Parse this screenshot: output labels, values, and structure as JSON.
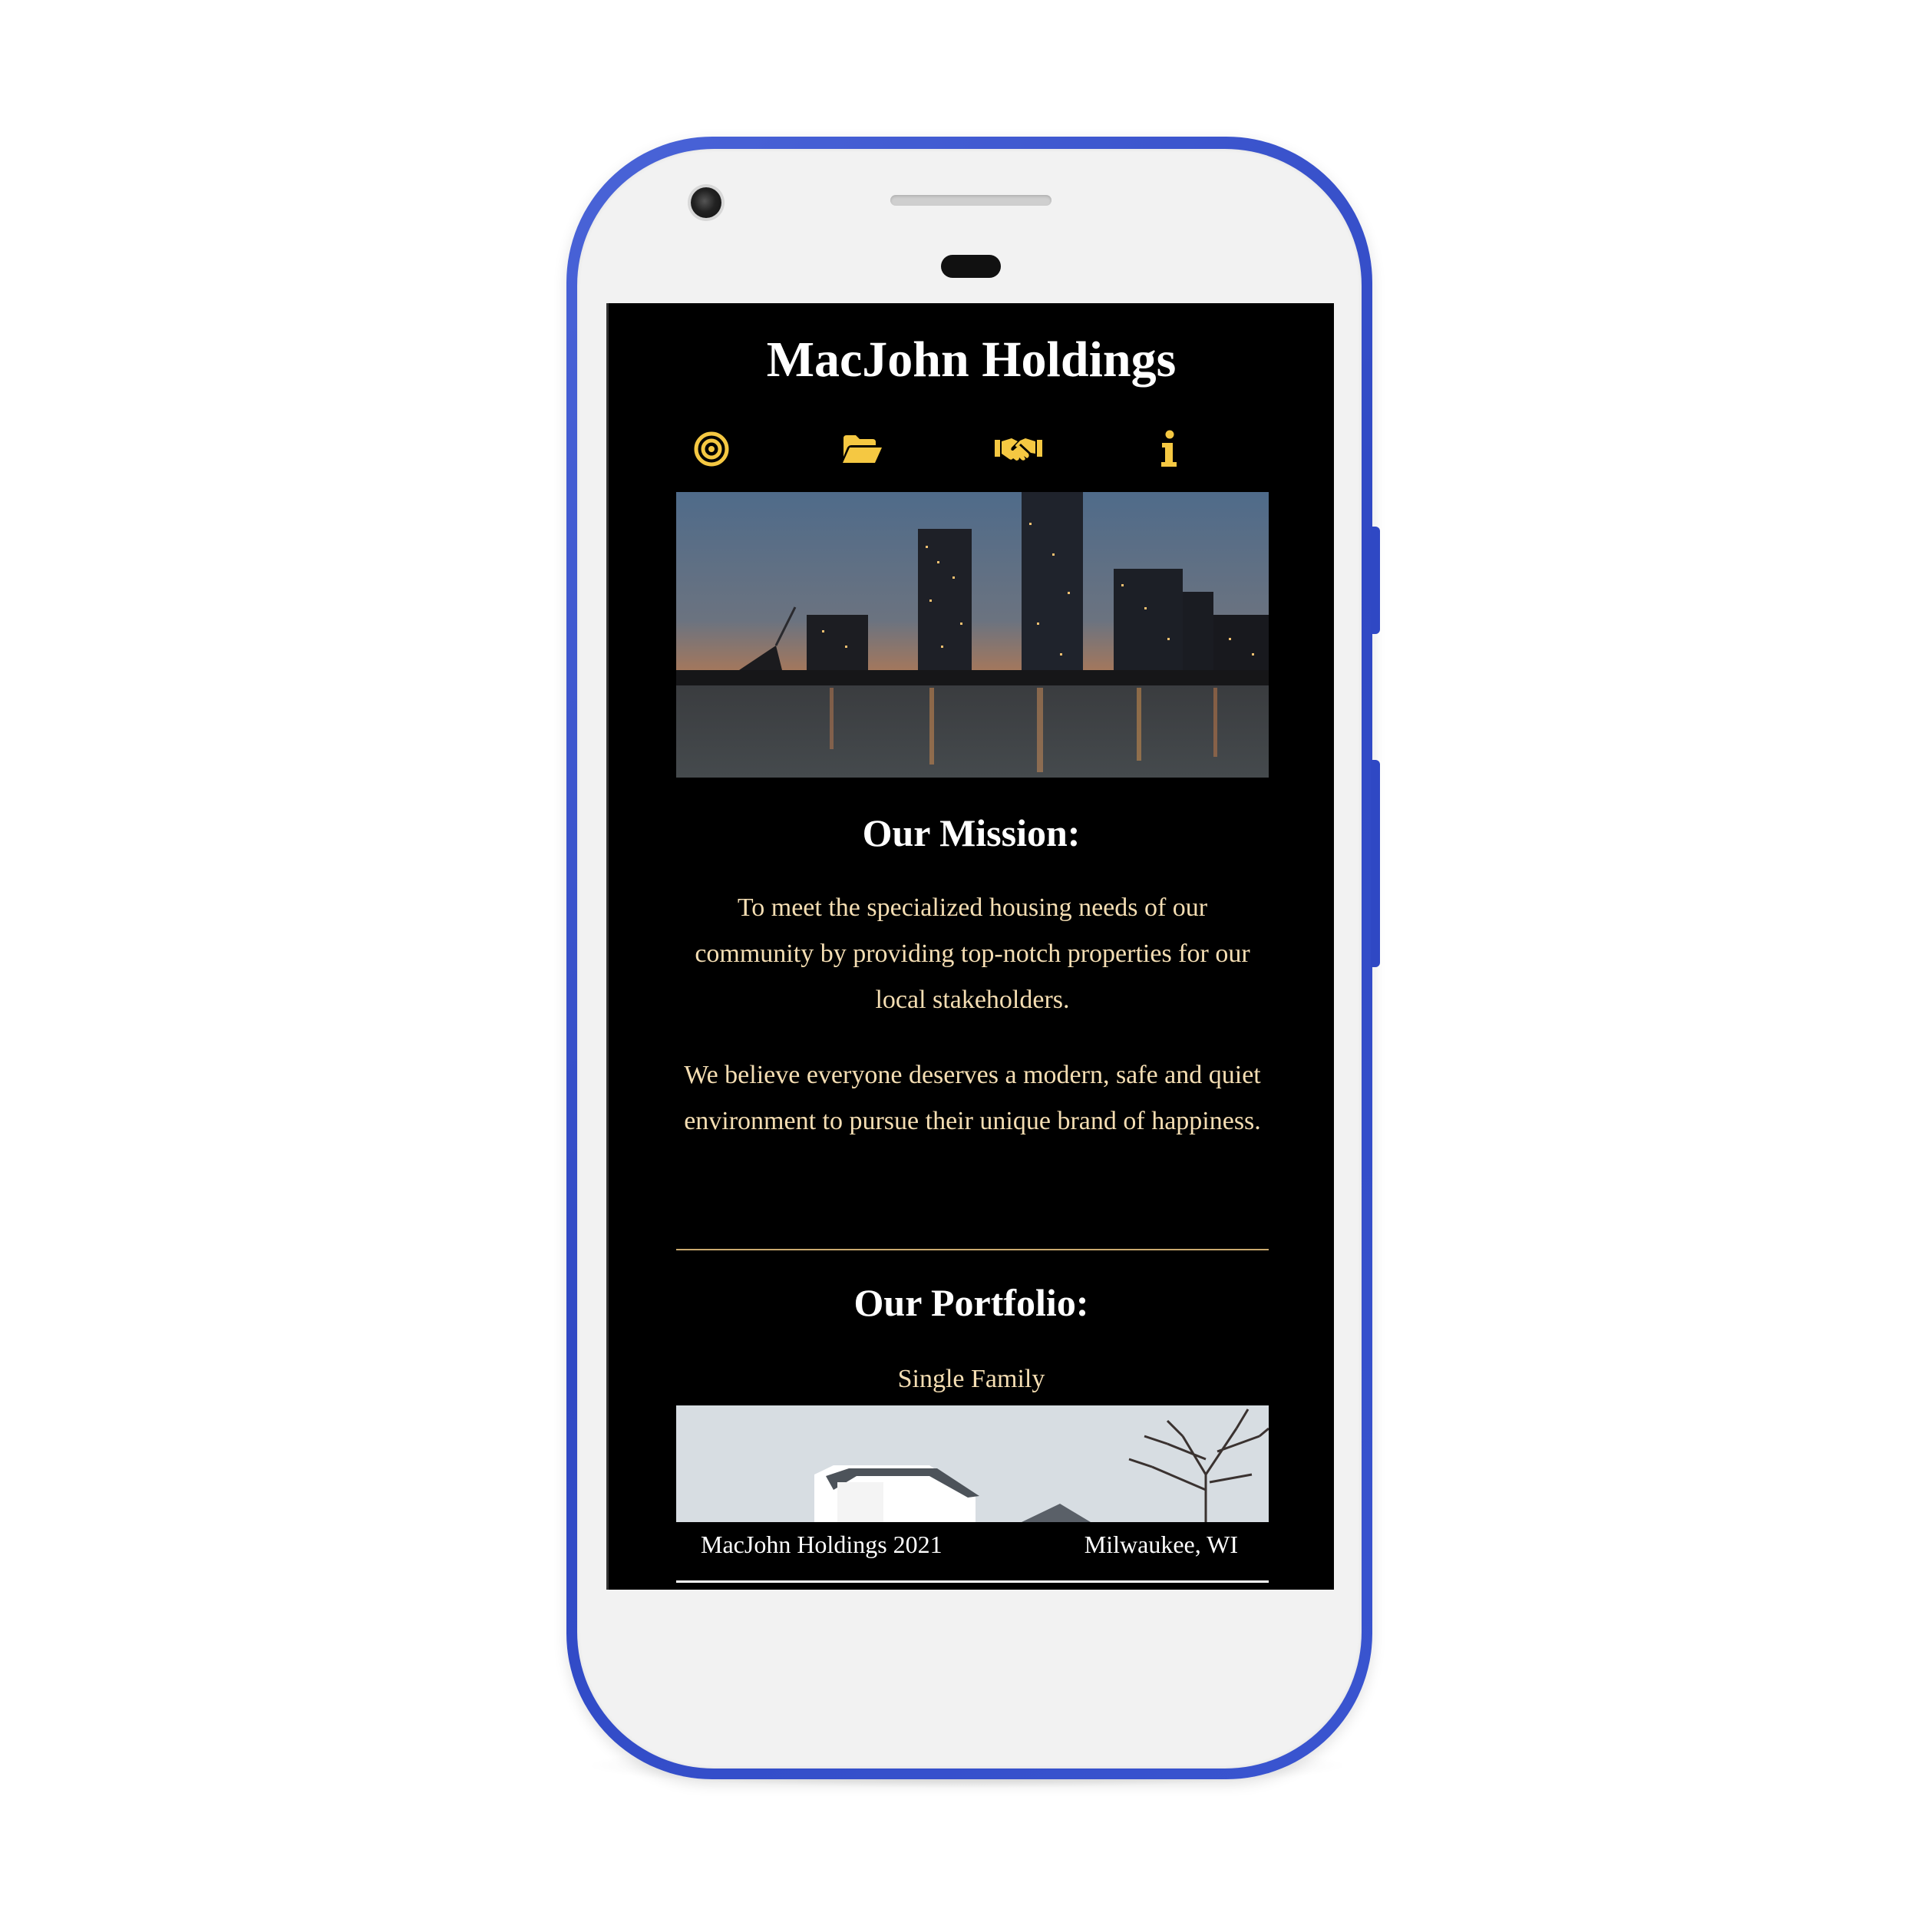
{
  "site": {
    "title": "MacJohn Holdings"
  },
  "nav": {
    "items": [
      {
        "icon": "target-icon",
        "color": "#f5c842"
      },
      {
        "icon": "folder-open-icon",
        "color": "#f5c842"
      },
      {
        "icon": "handshake-icon",
        "color": "#f5c842"
      },
      {
        "icon": "info-icon",
        "color": "#f5c842"
      }
    ]
  },
  "mission": {
    "heading": "Our Mission:",
    "paragraph_1": "To meet the specialized housing needs of our community by providing top-notch properties for our local stakeholders.",
    "paragraph_2": "We believe everyone deserves a modern, safe and quiet environment to pursue their unique brand of happiness."
  },
  "portfolio": {
    "heading": "Our Portfolio:",
    "category": "Single Family"
  },
  "footer": {
    "copyright": "MacJohn Holdings 2021",
    "location": "Milwaukee, WI"
  },
  "colors": {
    "accent": "#f5c842",
    "body_text": "#f5deb3",
    "background": "#000000",
    "phone_frame": "#2f48c4",
    "divider": "#c9a96e"
  }
}
